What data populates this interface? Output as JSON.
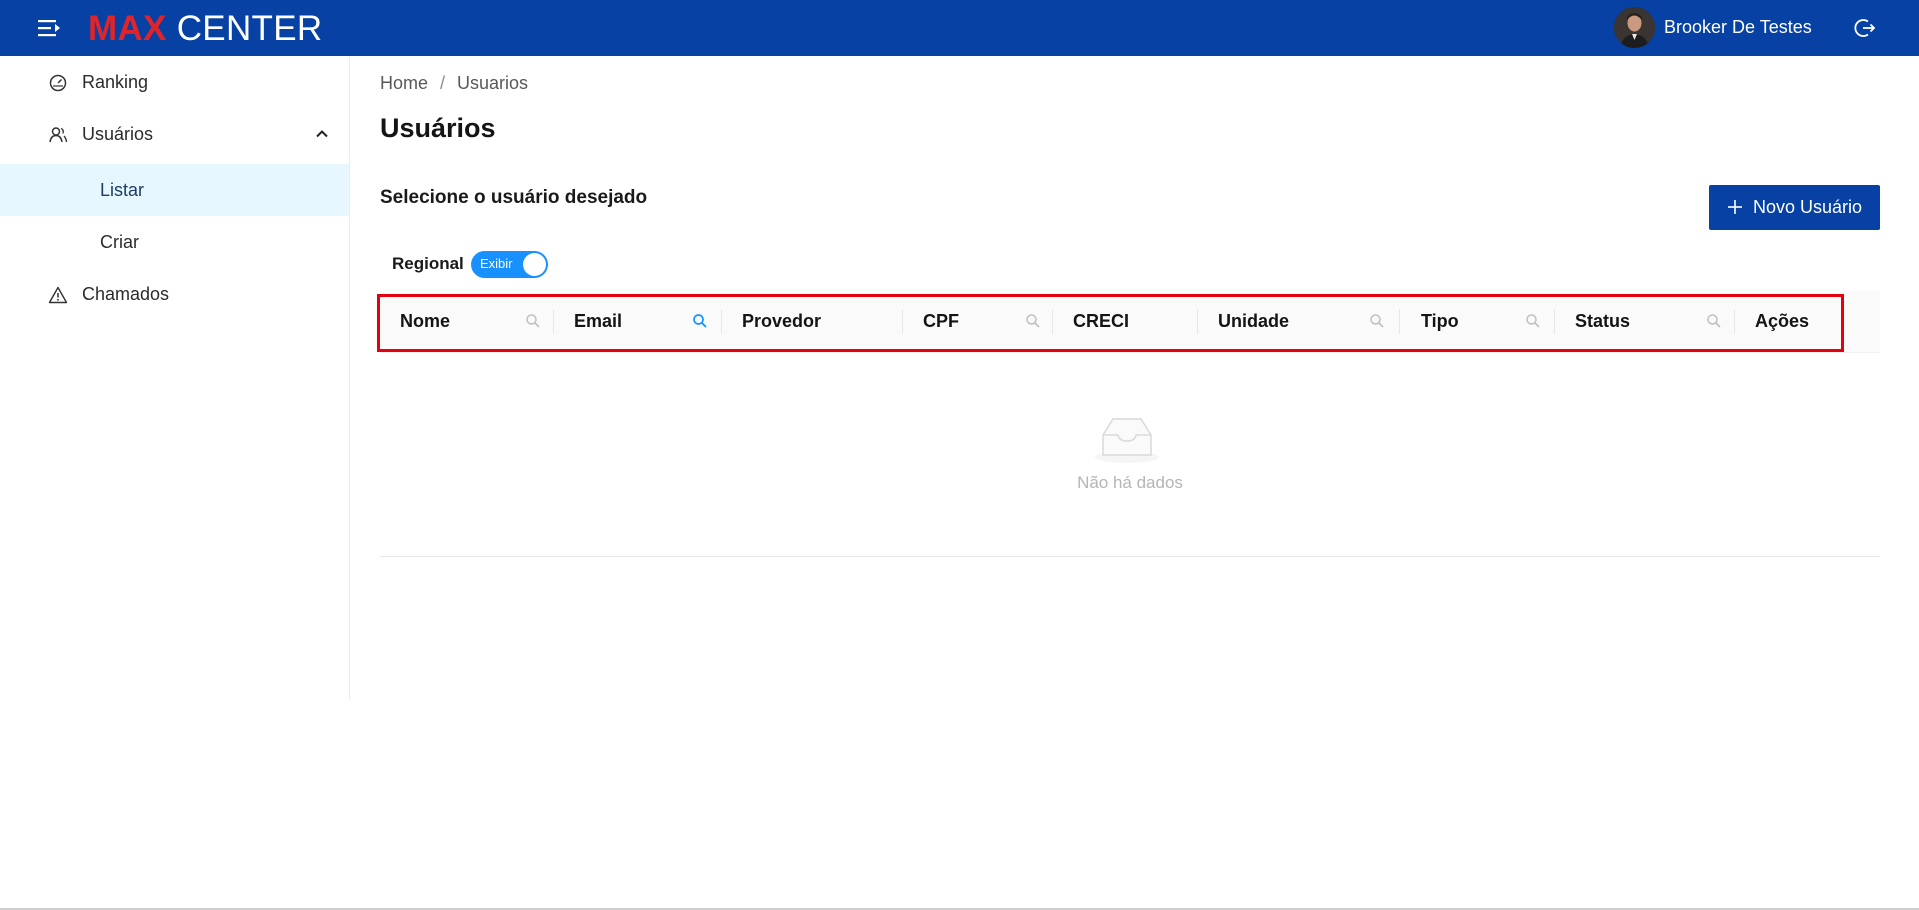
{
  "header": {
    "logo_max": "MAX",
    "logo_center": "CENTER",
    "user_name": "Brooker De Testes",
    "colors": {
      "bar": "#0641a3",
      "logo_accent": "#e0242a"
    },
    "icons": {
      "menu": "menu-fold-icon",
      "logout": "logout-icon"
    }
  },
  "sidebar": {
    "items": [
      {
        "label": "Ranking",
        "icon": "dashboard-icon"
      },
      {
        "label": "Usuários",
        "icon": "users-icon",
        "expanded": true,
        "children": [
          {
            "label": "Listar",
            "active": true
          },
          {
            "label": "Criar",
            "active": false
          }
        ]
      },
      {
        "label": "Chamados",
        "icon": "warning-icon"
      }
    ]
  },
  "breadcrumb": {
    "home": "Home",
    "separator": "/",
    "current": "Usuarios"
  },
  "page": {
    "title": "Usuários",
    "section_title": "Selecione o usuário desejado",
    "new_user_label": "Novo Usuário",
    "regional_label": "Regional",
    "regional_switch_text": "Exibir",
    "regional_switch_on": true
  },
  "table": {
    "columns": [
      {
        "label": "Nome",
        "searchable": true
      },
      {
        "label": "Email",
        "searchable": true,
        "search_active": true
      },
      {
        "label": "Provedor",
        "searchable": false
      },
      {
        "label": "CPF",
        "searchable": true
      },
      {
        "label": "CRECI",
        "searchable": false
      },
      {
        "label": "Unidade",
        "searchable": true
      },
      {
        "label": "Tipo",
        "searchable": true
      },
      {
        "label": "Status",
        "searchable": true
      },
      {
        "label": "Ações",
        "searchable": false
      }
    ],
    "empty_text": "Não há dados",
    "highlight_color": "#e3000f"
  }
}
